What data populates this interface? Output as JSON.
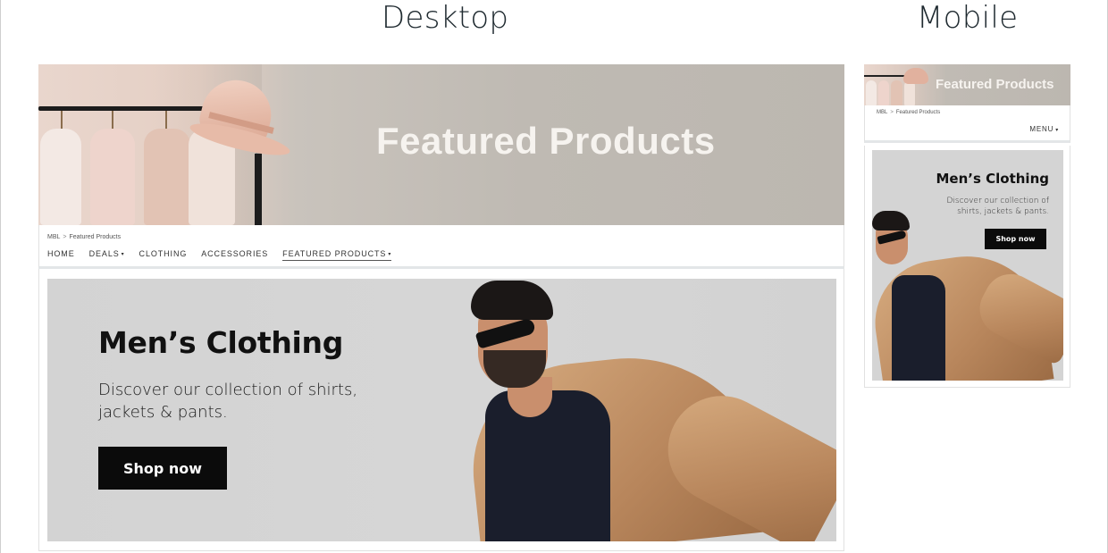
{
  "labels": {
    "desktop": "Desktop",
    "mobile": "Mobile"
  },
  "desktop": {
    "hero_title": "Featured Products",
    "breadcrumb": {
      "root": "MBL",
      "separator": ">",
      "current": "Featured Products"
    },
    "nav": [
      {
        "label": "HOME",
        "dropdown": false,
        "active": false
      },
      {
        "label": "DEALS",
        "dropdown": true,
        "active": false
      },
      {
        "label": "CLOTHING",
        "dropdown": false,
        "active": false
      },
      {
        "label": "ACCESSORIES",
        "dropdown": false,
        "active": false
      },
      {
        "label": "FEATURED PRODUCTS",
        "dropdown": true,
        "active": true
      }
    ],
    "dropdown_glyph": "▾",
    "promo": {
      "title": "Men’s Clothing",
      "description": "Discover our collection of shirts, jackets & pants.",
      "button": "Shop now"
    }
  },
  "mobile": {
    "hero_title": "Featured Products",
    "breadcrumb": {
      "root": "MBL",
      "separator": ">",
      "current": "Featured Products"
    },
    "menu_label": "MENU",
    "dropdown_glyph": "▾",
    "promo": {
      "title": "Men’s Clothing",
      "description": "Discover our collection of shirts, jackets & pants.",
      "button": "Shop now"
    }
  },
  "colors": {
    "button_bg": "#0b0b0b",
    "hero_bg": "#bcb7b0",
    "promo_bg": "#d3d3d3",
    "coat": "#c49366"
  }
}
